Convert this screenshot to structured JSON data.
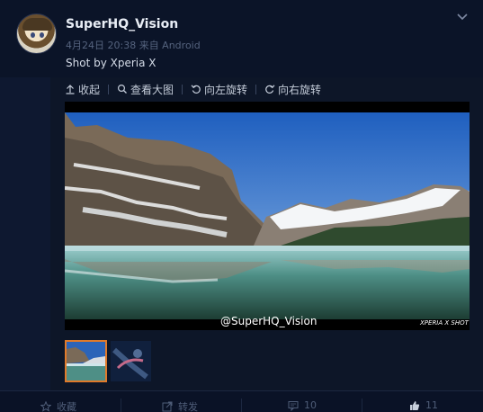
{
  "post": {
    "username": "SuperHQ_Vision",
    "meta": "4月24日 20:38 来自 Android",
    "text": "Shot by Xperia X"
  },
  "toolbar": {
    "collapse": "收起",
    "view_large": "查看大图",
    "rotate_left": "向左旋转",
    "rotate_right": "向右旋转"
  },
  "photo": {
    "watermark": "@SuperHQ_Vision",
    "camera_tag": "XPERIA X SHOT"
  },
  "actions": {
    "favorite": "收藏",
    "repost": "转发",
    "comment_count": "10",
    "like_count": "11"
  },
  "colors": {
    "selected_thumb_border": "#e07a2a",
    "background": "#0e1830"
  }
}
